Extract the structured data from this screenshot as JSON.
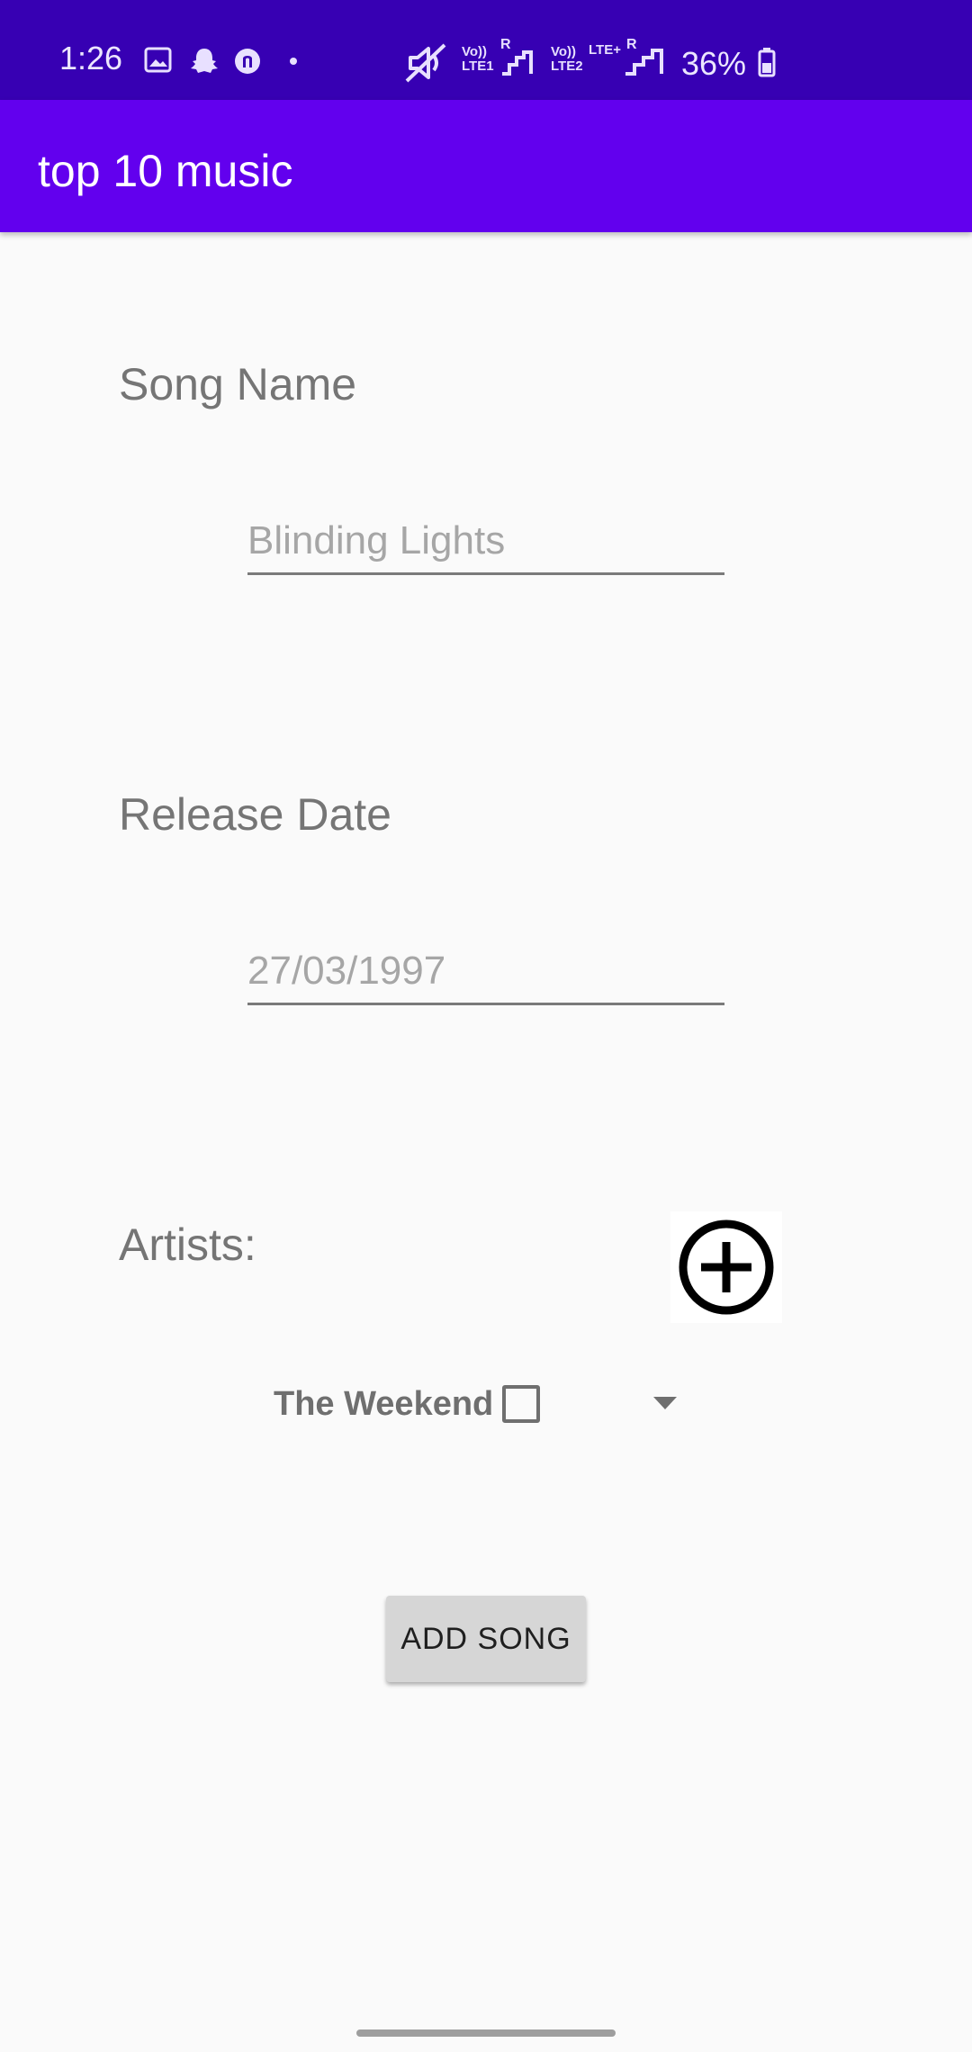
{
  "status_bar": {
    "time": "1:26",
    "battery": "36%",
    "sim1_label": "Vo))\nLTE1",
    "sim2_label": "Vo))\nLTE2",
    "lte_plus": "LTE+",
    "roaming": "R",
    "icons": [
      "gallery-icon",
      "snapchat-icon",
      "thread-icon",
      "dot-icon",
      "mute-icon",
      "signal-icon",
      "battery-icon"
    ]
  },
  "app_bar": {
    "title": "top 10 music"
  },
  "form": {
    "song_name_label": "Song Name",
    "song_name_placeholder": "Blinding Lights",
    "release_date_label": "Release Date",
    "release_date_placeholder": "27/03/1997",
    "artists_label": "Artists:",
    "artist_item": "The Weekend",
    "add_song_button": "ADD SONG"
  },
  "colors": {
    "status_bar": "#3700b3",
    "app_bar": "#6200ee",
    "background": "#fafafa"
  }
}
